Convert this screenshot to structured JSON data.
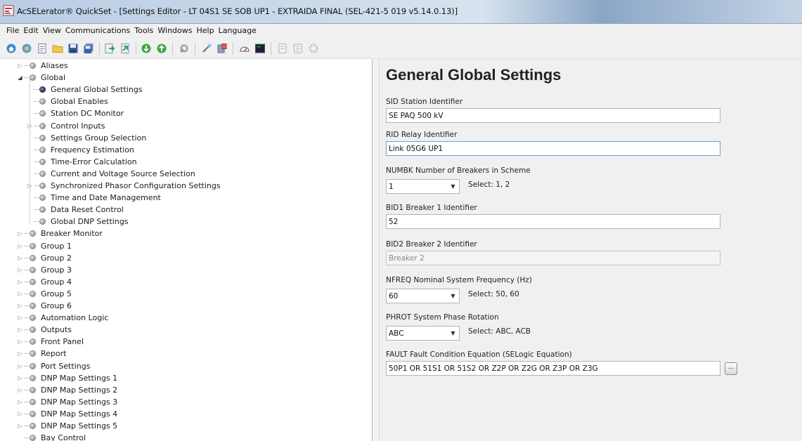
{
  "window": {
    "title": "AcSELerator® QuickSet - [Settings Editor - LT 04S1 SE SOB UP1 - EXTRAIDA FINAL (SEL-421-5 019 v5.14.0.13)]"
  },
  "menu": [
    "File",
    "Edit",
    "View",
    "Communications",
    "Tools",
    "Windows",
    "Help",
    "Language"
  ],
  "toolbar_icons": [
    "home-icon",
    "network-icon",
    "document-icon",
    "open-folder-icon",
    "save-icon",
    "save-all-icon",
    "export-icon",
    "import-icon",
    "green-down-icon",
    "green-up-icon",
    "settings-tool-icon",
    "wizard-icon",
    "device-icon",
    "meter-icon",
    "terminal-icon",
    "disabled-doc-icon",
    "disabled-list-icon",
    "disabled-gear-icon"
  ],
  "tree": [
    {
      "label": "Aliases",
      "level": 0,
      "expander": "collapsed"
    },
    {
      "label": "Global",
      "level": 0,
      "expander": "expanded"
    },
    {
      "label": "General Global Settings",
      "level": 1,
      "expander": "none",
      "selected": true
    },
    {
      "label": "Global Enables",
      "level": 1,
      "expander": "none"
    },
    {
      "label": "Station DC Monitor",
      "level": 1,
      "expander": "none"
    },
    {
      "label": "Control Inputs",
      "level": 1,
      "expander": "collapsed"
    },
    {
      "label": "Settings Group Selection",
      "level": 1,
      "expander": "none"
    },
    {
      "label": "Frequency Estimation",
      "level": 1,
      "expander": "none"
    },
    {
      "label": "Time-Error Calculation",
      "level": 1,
      "expander": "none"
    },
    {
      "label": "Current and Voltage Source Selection",
      "level": 1,
      "expander": "none"
    },
    {
      "label": "Synchronized Phasor Configuration Settings",
      "level": 1,
      "expander": "collapsed"
    },
    {
      "label": "Time and Date Management",
      "level": 1,
      "expander": "none"
    },
    {
      "label": "Data Reset Control",
      "level": 1,
      "expander": "none"
    },
    {
      "label": "Global DNP Settings",
      "level": 1,
      "expander": "none"
    },
    {
      "label": "Breaker Monitor",
      "level": 0,
      "expander": "collapsed"
    },
    {
      "label": "Group 1",
      "level": 0,
      "expander": "collapsed"
    },
    {
      "label": "Group 2",
      "level": 0,
      "expander": "collapsed"
    },
    {
      "label": "Group 3",
      "level": 0,
      "expander": "collapsed"
    },
    {
      "label": "Group 4",
      "level": 0,
      "expander": "collapsed"
    },
    {
      "label": "Group 5",
      "level": 0,
      "expander": "collapsed"
    },
    {
      "label": "Group 6",
      "level": 0,
      "expander": "collapsed"
    },
    {
      "label": "Automation Logic",
      "level": 0,
      "expander": "collapsed"
    },
    {
      "label": "Outputs",
      "level": 0,
      "expander": "collapsed"
    },
    {
      "label": "Front Panel",
      "level": 0,
      "expander": "collapsed"
    },
    {
      "label": "Report",
      "level": 0,
      "expander": "collapsed"
    },
    {
      "label": "Port Settings",
      "level": 0,
      "expander": "collapsed"
    },
    {
      "label": "DNP Map Settings 1",
      "level": 0,
      "expander": "collapsed"
    },
    {
      "label": "DNP Map Settings 2",
      "level": 0,
      "expander": "collapsed"
    },
    {
      "label": "DNP Map Settings 3",
      "level": 0,
      "expander": "collapsed"
    },
    {
      "label": "DNP Map Settings 4",
      "level": 0,
      "expander": "collapsed"
    },
    {
      "label": "DNP Map Settings 5",
      "level": 0,
      "expander": "collapsed"
    },
    {
      "label": "Bay Control",
      "level": 0,
      "expander": "none"
    }
  ],
  "settings": {
    "title": "General Global Settings",
    "sid": {
      "label": "SID  Station Identifier",
      "value": "SE PAQ 500 kV"
    },
    "rid": {
      "label": "RID  Relay Identifier",
      "value": "Link 05G6 UP1"
    },
    "numbk": {
      "label": "NUMBK  Number of Breakers in Scheme",
      "value": "1",
      "hint": "Select: 1, 2"
    },
    "bid1": {
      "label": "BID1  Breaker 1 Identifier",
      "value": "52"
    },
    "bid2": {
      "label": "BID2  Breaker 2 Identifier",
      "value": "Breaker 2"
    },
    "nfreq": {
      "label": "NFREQ  Nominal System Frequency (Hz)",
      "value": "60",
      "hint": "Select: 50, 60"
    },
    "phrot": {
      "label": "PHROT  System Phase Rotation",
      "value": "ABC",
      "hint": "Select: ABC, ACB"
    },
    "fault": {
      "label": "FAULT  Fault Condition Equation (SELogic Equation)",
      "value": "50P1 OR 51S1 OR 51S2 OR Z2P OR Z2G OR Z3P OR Z3G",
      "button": "..."
    }
  }
}
